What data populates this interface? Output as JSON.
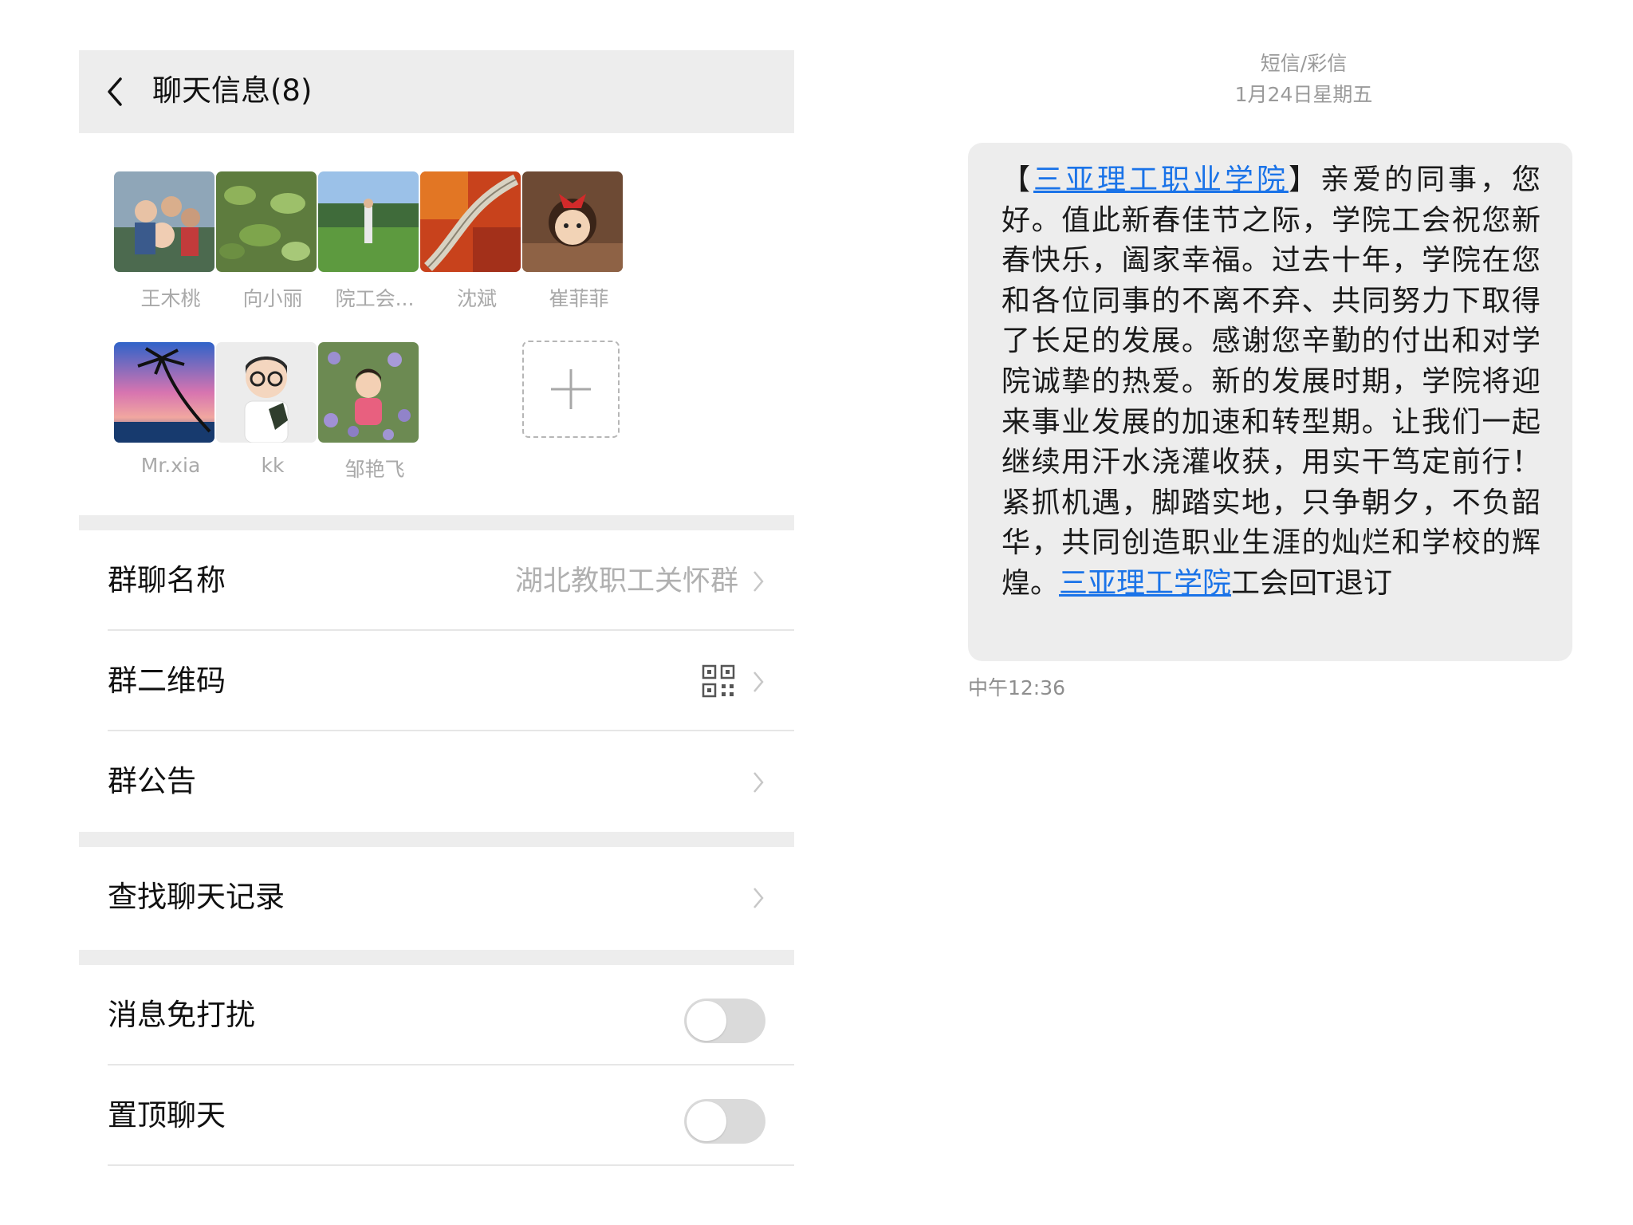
{
  "left": {
    "header": {
      "title": "聊天信息(8)"
    },
    "members": [
      {
        "name": "王木桃"
      },
      {
        "name": "向小丽"
      },
      {
        "name": "院工会..."
      },
      {
        "name": "沈斌"
      },
      {
        "name": "崔菲菲"
      },
      {
        "name": "Mr.xia"
      },
      {
        "name": "kk"
      },
      {
        "name": "邹艳飞"
      }
    ],
    "rows": {
      "group_name": {
        "label": "群聊名称",
        "value": "湖北教职工关怀群"
      },
      "qr_code": {
        "label": "群二维码"
      },
      "notice": {
        "label": "群公告"
      },
      "search_history": {
        "label": "查找聊天记录"
      },
      "mute": {
        "label": "消息免打扰",
        "on": false
      },
      "pin": {
        "label": "置顶聊天",
        "on": false
      }
    }
  },
  "sms": {
    "type_label": "短信/彩信",
    "date": "1月24日星期五",
    "message": {
      "bracket_open": "【",
      "link1": "三亚理工职业学院",
      "part1": "】亲爱的同事，您好。值此新春佳节之际，学院工会祝您新春快乐，阖家幸福。过去十年，学院在您和各位同事的不离不弃、共同努力下取得了长足的发展。感谢您辛勤的付出和对学院诚挚的热爱。新的发展时期，学院将迎来事业发展的加速和转型期。让我们一起继续用汗水浇灌收获，用实干笃定前行！紧抓机遇，脚踏实地，只争朝夕，不负韶华，共同创造职业生涯的灿烂和学校的辉煌。",
      "link2": "三亚理工学院",
      "part2": "工会回T退订"
    },
    "time": "中午12:36"
  },
  "colors": {
    "link": "#1a73e8",
    "header_bg": "#ededed",
    "bubble_bg": "#ededed"
  }
}
